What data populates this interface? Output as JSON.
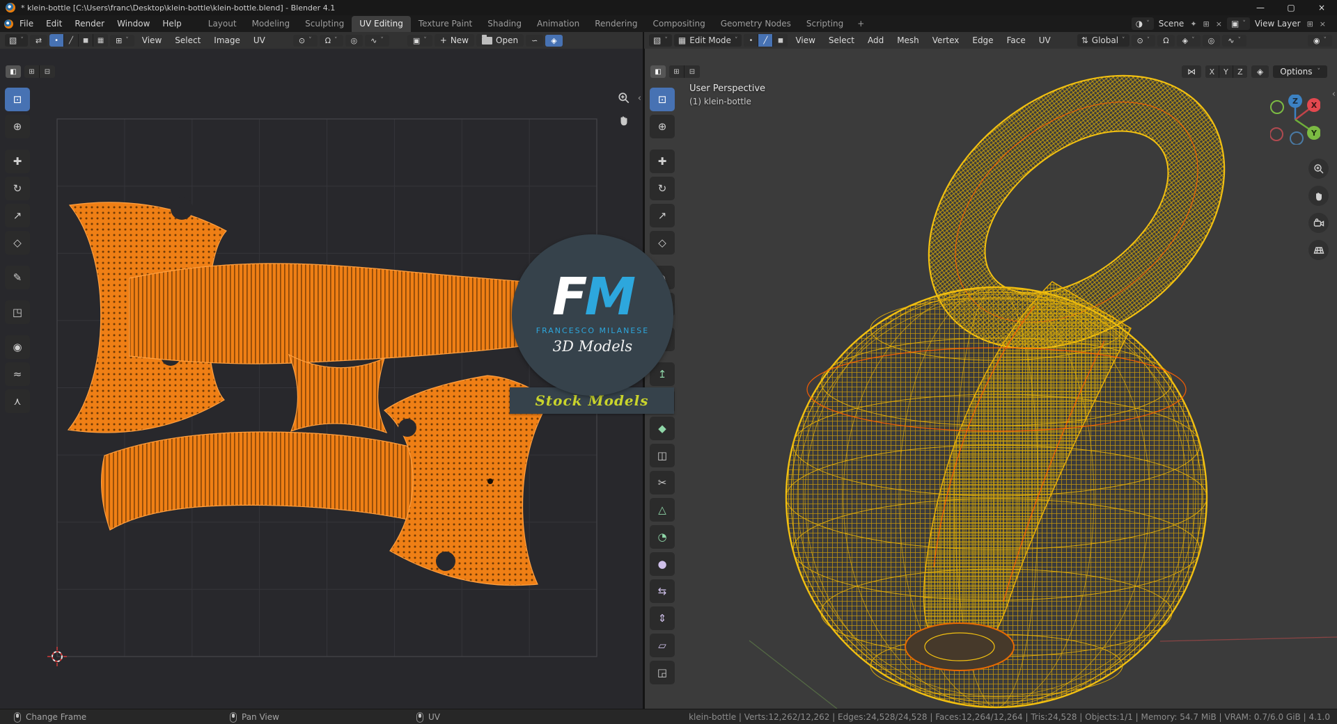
{
  "window": {
    "title": "* klein-bottle [C:\\Users\\franc\\Desktop\\klein-bottle\\klein-bottle.blend] - Blender 4.1",
    "controls": {
      "minimize": "—",
      "maximize": "▢",
      "close": "×"
    }
  },
  "topbar": {
    "menus": [
      "File",
      "Edit",
      "Render",
      "Window",
      "Help"
    ],
    "workspaces": [
      "Layout",
      "Modeling",
      "Sculpting",
      "UV Editing",
      "Texture Paint",
      "Shading",
      "Animation",
      "Rendering",
      "Compositing",
      "Geometry Nodes",
      "Scripting"
    ],
    "add_tab": "+",
    "scene_label": "Scene",
    "view_layer_label": "View Layer"
  },
  "icons": {
    "chevron": "˅",
    "editor_type": "▧",
    "uv_sync": "⇄",
    "sticky": "⊞",
    "select_vertex": "•",
    "select_edge": "╱",
    "select_face": "◼",
    "select_island": "▦",
    "pivot": "⊙",
    "magnet": "Ω",
    "proportional": "◎",
    "falloff": "∿",
    "image": "▣",
    "plus": "+",
    "link": "∽",
    "pin_blue": "◈",
    "orientation": "⇅",
    "eye": "◉",
    "mirror": "⋈",
    "snap_project": "◈",
    "scene": "◑",
    "view_layer": "▣",
    "pin": "✦",
    "duplicate": "⊞",
    "close_small": "×",
    "back": "‹",
    "mode_cube": "▦"
  },
  "uv_tools": [
    {
      "name": "select-box",
      "glyph": "⊡"
    },
    {
      "name": "cursor-2d",
      "glyph": "⊕"
    },
    {
      "name": "move",
      "glyph": "✚"
    },
    {
      "name": "rotate",
      "glyph": "↻"
    },
    {
      "name": "scale",
      "glyph": "↗"
    },
    {
      "name": "transform",
      "glyph": "◇"
    },
    {
      "name": "annotate",
      "glyph": "✎"
    },
    {
      "name": "rip-region",
      "glyph": "◳"
    },
    {
      "name": "grab",
      "glyph": "◉"
    },
    {
      "name": "relax",
      "glyph": "≈"
    },
    {
      "name": "pinch",
      "glyph": "⋏"
    }
  ],
  "vp_tools": [
    {
      "name": "select-box",
      "glyph": "⊡"
    },
    {
      "name": "cursor-3d",
      "glyph": "⊕"
    },
    {
      "name": "move",
      "glyph": "✚"
    },
    {
      "name": "rotate",
      "glyph": "↻"
    },
    {
      "name": "scale",
      "glyph": "↗"
    },
    {
      "name": "transform",
      "glyph": "◇"
    },
    {
      "name": "annotate",
      "glyph": "✎"
    },
    {
      "name": "measure",
      "glyph": "∡"
    },
    {
      "name": "add-cube",
      "glyph": "▦"
    },
    {
      "name": "extrude-region",
      "glyph": "↥"
    },
    {
      "name": "inset-faces",
      "glyph": "⊡"
    },
    {
      "name": "bevel",
      "glyph": "◆"
    },
    {
      "name": "loop-cut",
      "glyph": "◫"
    },
    {
      "name": "knife",
      "glyph": "✂"
    },
    {
      "name": "poly-build",
      "glyph": "△"
    },
    {
      "name": "spin",
      "glyph": "◔"
    },
    {
      "name": "smooth",
      "glyph": "●"
    },
    {
      "name": "edge-slide",
      "glyph": "⇆"
    },
    {
      "name": "shrink-fatten",
      "glyph": "⇕"
    },
    {
      "name": "shear",
      "glyph": "▱"
    },
    {
      "name": "rip-region",
      "glyph": "◲"
    }
  ],
  "uv_editor": {
    "menus": [
      "View",
      "Select",
      "Image",
      "UV"
    ],
    "new_label": "New",
    "open_label": "Open"
  },
  "viewport": {
    "mode_label": "Edit Mode",
    "menus": [
      "View",
      "Select",
      "Add",
      "Mesh",
      "Vertex",
      "Edge",
      "Face",
      "UV"
    ],
    "orientation_label": "Global",
    "options_label": "Options",
    "axes": [
      "X",
      "Y",
      "Z"
    ],
    "overlay": [
      "User Perspective",
      "(1) klein-bottle"
    ],
    "gizmo": {
      "x": "X",
      "y": "Y",
      "z": "Z"
    }
  },
  "watermark": {
    "f": "F",
    "m": "M",
    "name": "FRANCESCO MILANESE",
    "subtitle": "3D Models",
    "ribbon": "Stock Models"
  },
  "status_bar": {
    "hints": [
      "Change Frame",
      "Pan View",
      "UV"
    ],
    "stats": "klein-bottle | Verts:12,262/12,262 | Edges:24,528/24,528 | Faces:12,264/12,264 | Tris:24,528 | Objects:1/1 | Memory: 54.7 MiB | VRAM: 0.7/6.0 GiB | 4.1.0"
  },
  "colors": {
    "accent": "#4772b3",
    "uv_orange": "#ef7f15",
    "wire_yellow": "#f2c011",
    "wire_orange": "#ff5f00",
    "watermark_blue": "#2da7dd",
    "ribbon_text": "#c9d42c"
  }
}
